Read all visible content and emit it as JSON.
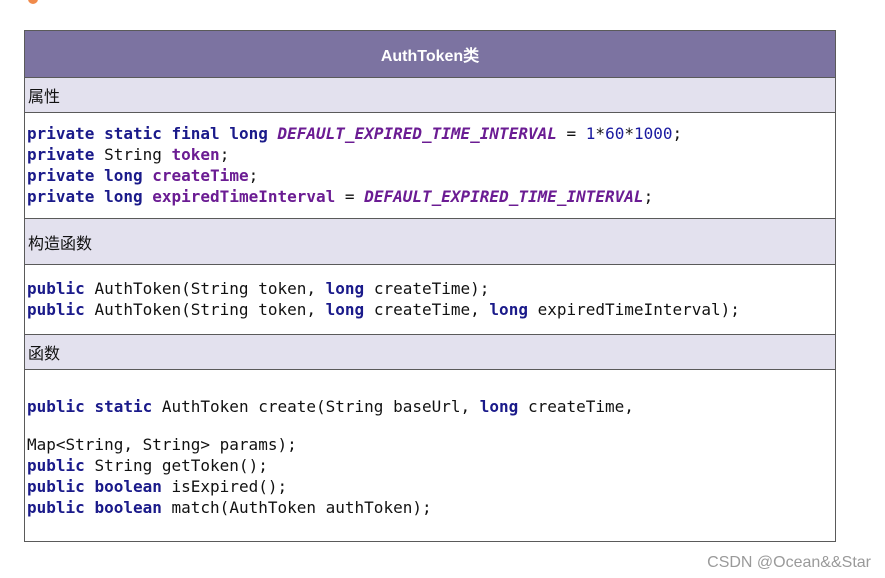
{
  "title": "AuthToken类",
  "sections": {
    "attributes": "属性",
    "constructors": "构造函数",
    "functions": "函数"
  },
  "tokens": {
    "private": "private",
    "public": "public",
    "static": "static",
    "final": "final",
    "long": "long",
    "boolean": "boolean",
    "String": "String",
    "default_const": "DEFAULT_EXPIRED_TIME_INTERVAL",
    "eq": "=",
    "num1": "1",
    "num60": "60",
    "num1000": "1000",
    "mul": "*",
    "semi": ";",
    "token": "token",
    "createTime": "createTime",
    "expiredTimeInterval": "expiredTimeInterval",
    "ctor1": "AuthToken(String token,",
    "ctor1_end": "createTime);",
    "ctor2": "AuthToken(String token,",
    "ctor2_mid": "createTime,",
    "ctor2_end": "expiredTimeInterval);",
    "create_start": "AuthToken create(String baseUrl,",
    "create_end": "createTime,",
    "create_cont": "Map<String, String> params);",
    "getToken": "String getToken();",
    "isExpired": "isExpired();",
    "match": "match(AuthToken authToken);"
  },
  "watermark": "CSDN @Ocean&&Star"
}
